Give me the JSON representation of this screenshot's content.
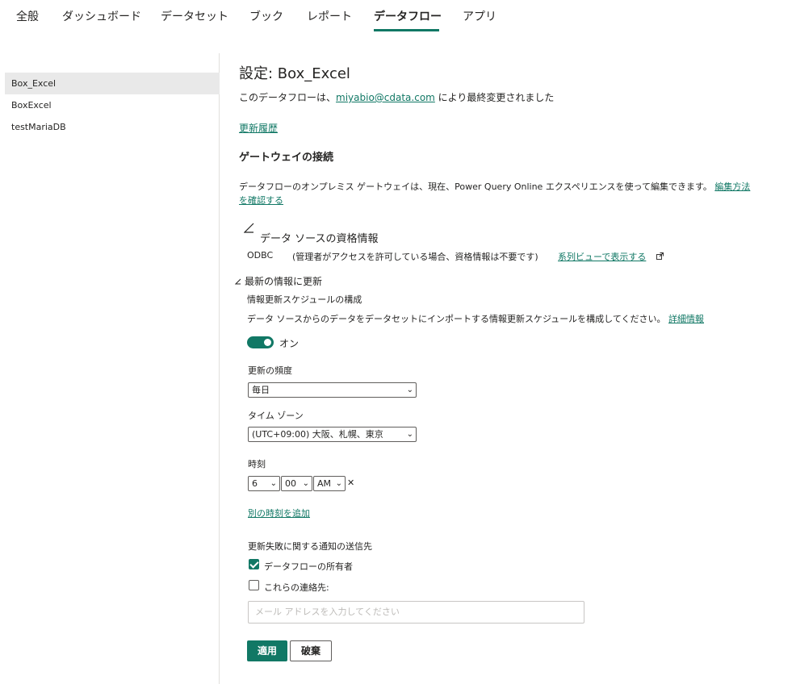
{
  "tabs": [
    {
      "label": "全般"
    },
    {
      "label": "ダッシュボード"
    },
    {
      "label": "データセット"
    },
    {
      "label": "ブック"
    },
    {
      "label": "レポート"
    },
    {
      "label": "データフロー"
    },
    {
      "label": "アプリ"
    }
  ],
  "active_tab": "データフロー",
  "sidebar": {
    "items": [
      {
        "label": "Box_Excel",
        "selected": true
      },
      {
        "label": "BoxExcel"
      },
      {
        "label": "testMariaDB"
      }
    ]
  },
  "main": {
    "title": "設定: Box_Excel",
    "modified_prefix": "このデータフローは、",
    "modified_user": "miyabio@cdata.com",
    "modified_suffix": " により最終変更されました",
    "history_link": "更新履歴",
    "gateway": {
      "heading": "ゲートウェイの接続",
      "text": "データフローのオンプレミス ゲートウェイは、現在、Power Query Online エクスペリエンスを使って編集できます。",
      "link_line1": "編集方法",
      "link_line2": "を確認する"
    },
    "credentials": {
      "heading": "データ ソースの資格情報",
      "type": "ODBC",
      "note": "(管理者がアクセスを許可している場合、資格情報は不要です)",
      "link": "系列ビューで表示する"
    },
    "refresh": {
      "heading": "最新の情報に更新",
      "schedule_label": "情報更新スケジュールの構成",
      "schedule_desc": "データ ソースからのデータをデータセットにインポートする情報更新スケジュールを構成してください。",
      "details_link": "詳細情報",
      "toggle_label": "オン",
      "frequency_label": "更新の頻度",
      "frequency_value": "毎日",
      "timezone_label": "タイム ゾーン",
      "timezone_value": "(UTC+09:00) 大阪、札幌、東京",
      "time_label": "時刻",
      "hour": "6",
      "minute": "00",
      "ampm": "AM",
      "remove_symbol": "✕",
      "add_time_link": "別の時刻を追加"
    },
    "notify": {
      "label": "更新失敗に関する通知の送信先",
      "owner_label": "データフローの所有者",
      "contacts_label": "これらの連絡先:",
      "email_placeholder": "メール アドレスを入力してください"
    },
    "apply_button": "適用",
    "discard_button": "破棄"
  },
  "colors": {
    "accent": "#117865"
  },
  "icons": {
    "collapse": "collapse-triangle-icon",
    "external": "external-link-icon",
    "chevron": "chevron-down-icon"
  }
}
